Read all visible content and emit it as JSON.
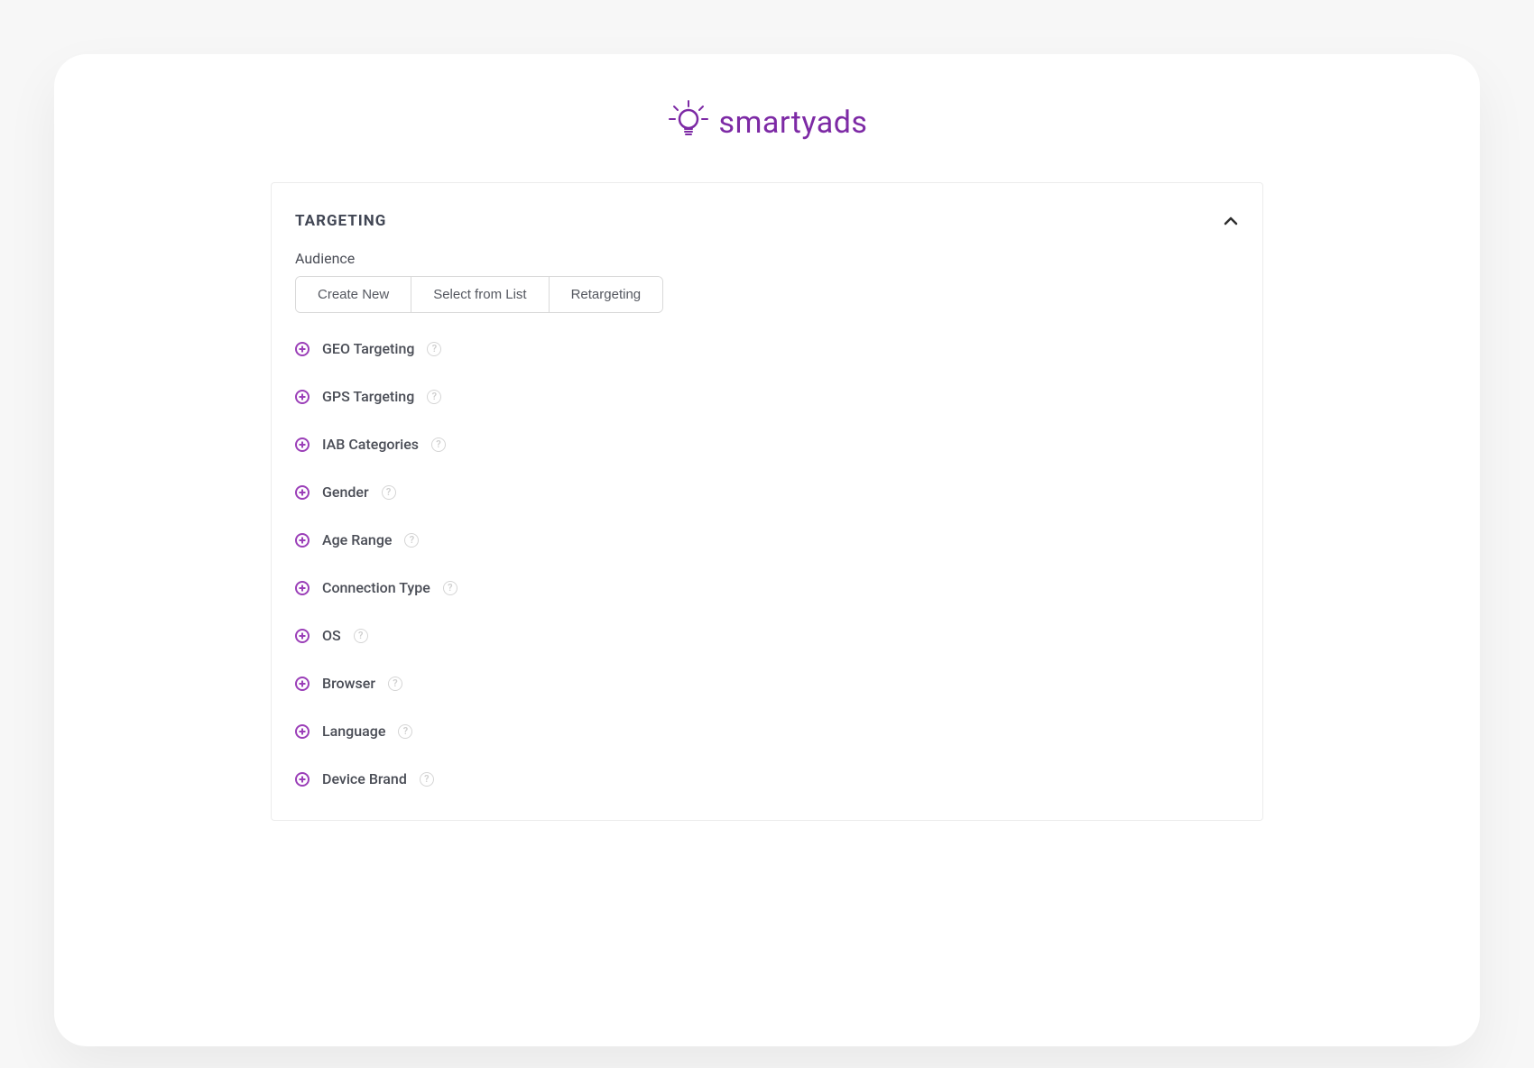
{
  "brand": {
    "name": "smartyads",
    "accent_color": "#7d2aa5"
  },
  "panel": {
    "title": "TARGETING",
    "audience_label": "Audience",
    "segmented": [
      {
        "label": "Create New"
      },
      {
        "label": "Select from List"
      },
      {
        "label": "Retargeting"
      }
    ],
    "items": [
      {
        "label": "GEO Targeting"
      },
      {
        "label": "GPS Targeting"
      },
      {
        "label": "IAB Categories"
      },
      {
        "label": "Gender"
      },
      {
        "label": "Age Range"
      },
      {
        "label": "Connection Type"
      },
      {
        "label": "OS"
      },
      {
        "label": "Browser"
      },
      {
        "label": "Language"
      },
      {
        "label": "Device Brand"
      }
    ]
  }
}
